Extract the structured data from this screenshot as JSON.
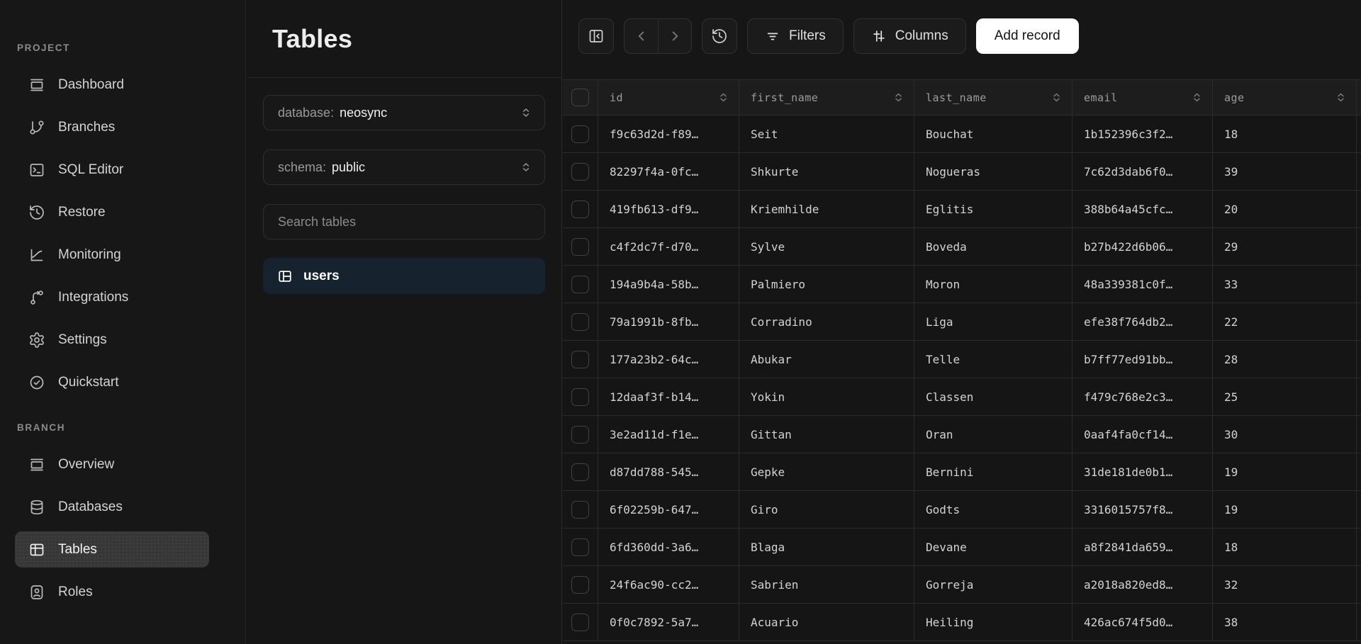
{
  "sidebar": {
    "sections": [
      {
        "label": "PROJECT",
        "items": [
          {
            "label": "Dashboard",
            "icon": "dashboard-icon"
          },
          {
            "label": "Branches",
            "icon": "git-branch-icon"
          },
          {
            "label": "SQL Editor",
            "icon": "terminal-icon"
          },
          {
            "label": "Restore",
            "icon": "history-icon"
          },
          {
            "label": "Monitoring",
            "icon": "chart-icon"
          },
          {
            "label": "Integrations",
            "icon": "route-icon"
          },
          {
            "label": "Settings",
            "icon": "gear-icon"
          },
          {
            "label": "Quickstart",
            "icon": "check-circle-icon"
          }
        ]
      },
      {
        "label": "BRANCH",
        "items": [
          {
            "label": "Overview",
            "icon": "window-icon"
          },
          {
            "label": "Databases",
            "icon": "database-icon"
          },
          {
            "label": "Tables",
            "icon": "table-icon",
            "selected": true
          },
          {
            "label": "Roles",
            "icon": "badge-user-icon"
          }
        ]
      }
    ]
  },
  "panel": {
    "title": "Tables",
    "database_select": {
      "label": "database:",
      "value": "neosync"
    },
    "schema_select": {
      "label": "schema:",
      "value": "public"
    },
    "search_placeholder": "Search tables",
    "tables": [
      {
        "name": "users",
        "selected": true,
        "icon": "table-icon"
      }
    ]
  },
  "toolbar": {
    "collapse_icon": "panel-collapse-icon",
    "prev_icon": "chevron-left-icon",
    "next_icon": "chevron-right-icon",
    "history_icon": "history-icon",
    "filters_label": "Filters",
    "columns_label": "Columns",
    "add_record_label": "Add record"
  },
  "table": {
    "columns": [
      "id",
      "first_name",
      "last_name",
      "email",
      "age"
    ],
    "rows": [
      [
        "f9c63d2d-f89…",
        "Seit",
        "Bouchat",
        "1b152396c3f2…",
        "18"
      ],
      [
        "82297f4a-0fc…",
        "Shkurte",
        "Nogueras",
        "7c62d3dab6f0…",
        "39"
      ],
      [
        "419fb613-df9…",
        "Kriemhilde",
        "Eglitis",
        "388b64a45cfc…",
        "20"
      ],
      [
        "c4f2dc7f-d70…",
        "Sylve",
        "Boveda",
        "b27b422d6b06…",
        "29"
      ],
      [
        "194a9b4a-58b…",
        "Palmiero",
        "Moron",
        "48a339381c0f…",
        "33"
      ],
      [
        "79a1991b-8fb…",
        "Corradino",
        "Liga",
        "efe38f764db2…",
        "22"
      ],
      [
        "177a23b2-64c…",
        "Abukar",
        "Telle",
        "b7ff77ed91bb…",
        "28"
      ],
      [
        "12daaf3f-b14…",
        "Yokin",
        "Classen",
        "f479c768e2c3…",
        "25"
      ],
      [
        "3e2ad11d-f1e…",
        "Gittan",
        "Oran",
        "0aaf4fa0cf14…",
        "30"
      ],
      [
        "d87dd788-545…",
        "Gepke",
        "Bernini",
        "31de181de0b1…",
        "19"
      ],
      [
        "6f02259b-647…",
        "Giro",
        "Godts",
        "3316015757f8…",
        "19"
      ],
      [
        "6fd360dd-3a6…",
        "Blaga",
        "Devane",
        "a8f2841da659…",
        "18"
      ],
      [
        "24f6ac90-cc2…",
        "Sabrien",
        "Gorreja",
        "a2018a820ed8…",
        "32"
      ],
      [
        "0f0c7892-5a7…",
        "Acuario",
        "Heiling",
        "426ac674f5d0…",
        "38"
      ]
    ]
  },
  "colors": {
    "background": "#161616",
    "panel_border": "#2a2a2a",
    "selected_nav_bg": "#373737",
    "selected_table_bg": "#17222f",
    "primary_button_bg": "#ffffff",
    "primary_button_text": "#131313",
    "header_row_bg": "#1d1d1d",
    "grid_border": "#2b2b2b"
  }
}
